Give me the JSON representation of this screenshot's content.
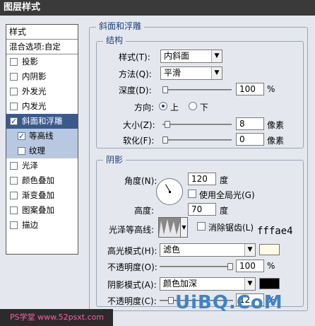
{
  "window": {
    "title": "图层样式"
  },
  "left_panel": {
    "header": "样式",
    "blend": "混合选项:自定",
    "items": [
      {
        "label": "投影",
        "checked": false
      },
      {
        "label": "内阴影",
        "checked": false
      },
      {
        "label": "外发光",
        "checked": false
      },
      {
        "label": "内发光",
        "checked": false
      },
      {
        "label": "斜面和浮雕",
        "checked": true,
        "active": true
      },
      {
        "label": "等高线",
        "checked": true,
        "sub": true
      },
      {
        "label": "纹理",
        "checked": false,
        "sub": true
      },
      {
        "label": "光泽",
        "checked": false
      },
      {
        "label": "颜色叠加",
        "checked": false
      },
      {
        "label": "渐变叠加",
        "checked": false
      },
      {
        "label": "图案叠加",
        "checked": false
      },
      {
        "label": "描边",
        "checked": false
      }
    ]
  },
  "bevel": {
    "title": "斜面和浮雕",
    "structure": {
      "title": "结构",
      "style_label": "样式(T):",
      "style_value": "内斜面",
      "technique_label": "方法(Q):",
      "technique_value": "平滑",
      "depth_label": "深度(D):",
      "depth_value": "100",
      "depth_unit": "%",
      "depth_fraction": 0.0,
      "direction_label": "方向:",
      "dir_up": "上",
      "dir_down": "下",
      "size_label": "大小(Z):",
      "size_value": "8",
      "size_unit": "像素",
      "size_fraction": 0.03,
      "soften_label": "软化(F):",
      "soften_value": "0",
      "soften_unit": "像素",
      "soften_fraction": 0.0
    },
    "shading": {
      "title": "阴影",
      "angle_label": "角度(N):",
      "angle_value": "120",
      "angle_unit": "度",
      "global_light_label": "使用全局光(G)",
      "altitude_label": "高度:",
      "altitude_value": "70",
      "altitude_unit": "度",
      "gloss_label": "光泽等高线:",
      "antialias_label": "消除锯齿(L)",
      "highlight_label": "高光模式(H):",
      "highlight_value": "滤色",
      "highlight_color": "#fffae4",
      "highlight_opacity_label": "不透明度(O):",
      "highlight_opacity_value": "100",
      "highlight_opacity_unit": "%",
      "highlight_opacity_fraction": 1.0,
      "shadow_label": "阴影模式(A):",
      "shadow_value": "颜色加深",
      "shadow_color": "#000000",
      "shadow_opacity_label": "不透明度(C):",
      "shadow_opacity_value": "12",
      "shadow_opacity_unit": "%",
      "shadow_opacity_fraction": 0.12
    }
  },
  "annotation": {
    "text": "fffae4"
  },
  "watermark": {
    "text": "UiBQ.CoM"
  },
  "bottom_logo": {
    "text": "PS学堂 www.52psxt.com"
  }
}
